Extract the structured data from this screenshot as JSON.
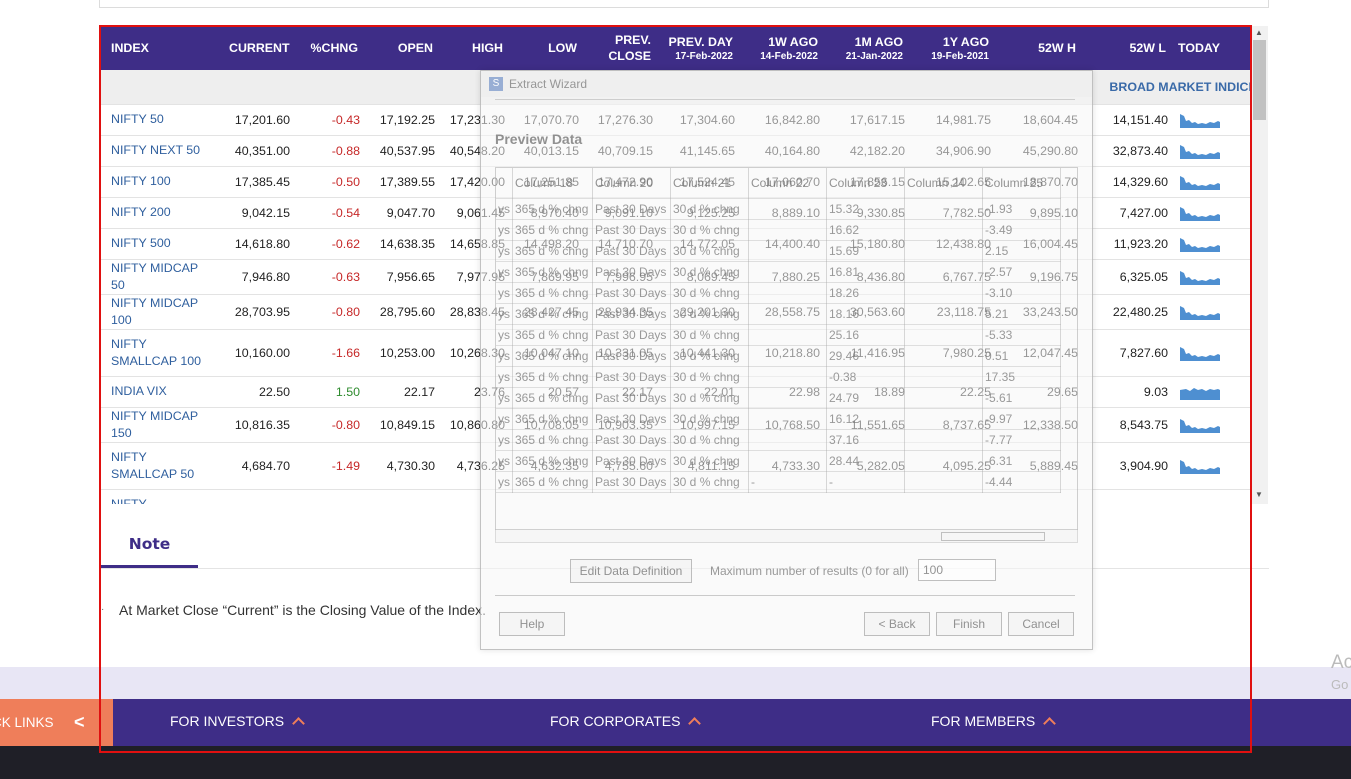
{
  "table": {
    "headers": [
      {
        "label": "INDEX",
        "sub": ""
      },
      {
        "label": "CURRENT",
        "sub": ""
      },
      {
        "label": "%CHNG",
        "sub": ""
      },
      {
        "label": "OPEN",
        "sub": ""
      },
      {
        "label": "HIGH",
        "sub": ""
      },
      {
        "label": "LOW",
        "sub": ""
      },
      {
        "label": "PREV. CLOSE",
        "sub": ""
      },
      {
        "label": "PREV. DAY",
        "sub": "17-Feb-2022"
      },
      {
        "label": "1W AGO",
        "sub": "14-Feb-2022"
      },
      {
        "label": "1M AGO",
        "sub": "21-Jan-2022"
      },
      {
        "label": "1Y AGO",
        "sub": "19-Feb-2021"
      },
      {
        "label": "52W H",
        "sub": ""
      },
      {
        "label": "52W L",
        "sub": ""
      },
      {
        "label": "TODAY",
        "sub": ""
      }
    ],
    "group": "BROAD MARKET INDICES",
    "rows": [
      {
        "name": "NIFTY 50",
        "current": "17,201.60",
        "chng": "-0.43",
        "open": "17,192.25",
        "high": "17,231.30",
        "low": "17,070.70",
        "prev_close": "17,276.30",
        "prev_day": "17,304.60",
        "w1": "16,842.80",
        "m1": "17,617.15",
        "y1": "14,981.75",
        "h52": "18,604.45",
        "l52": "14,151.40",
        "dir": "neg",
        "spark": "down"
      },
      {
        "name": "NIFTY NEXT 50",
        "current": "40,351.00",
        "chng": "-0.88",
        "open": "40,537.95",
        "high": "40,548.20",
        "low": "40,013.15",
        "prev_close": "40,709.15",
        "prev_day": "41,145.65",
        "w1": "40,164.80",
        "m1": "42,182.20",
        "y1": "34,906.90",
        "h52": "45,290.80",
        "l52": "32,873.40",
        "dir": "neg",
        "spark": "down"
      },
      {
        "name": "NIFTY 100",
        "current": "17,385.45",
        "chng": "-0.50",
        "open": "17,389.55",
        "high": "17,420.00",
        "low": "17,251.85",
        "prev_close": "17,472.90",
        "prev_day": "17,524.45",
        "w1": "17,060.70",
        "m1": "17,856.15",
        "y1": "15,102.65",
        "h52": "18,870.70",
        "l52": "14,329.60",
        "dir": "neg",
        "spark": "down"
      },
      {
        "name": "NIFTY 200",
        "current": "9,042.15",
        "chng": "-0.54",
        "open": "9,047.70",
        "high": "9,061.45",
        "low": "8,970.40",
        "prev_close": "9,091.10",
        "prev_day": "9,125.25",
        "w1": "8,889.10",
        "m1": "9,330.85",
        "y1": "7,782.50",
        "h52": "9,895.10",
        "l52": "7,427.00",
        "dir": "neg",
        "spark": "down"
      },
      {
        "name": "NIFTY 500",
        "current": "14,618.80",
        "chng": "-0.62",
        "open": "14,638.35",
        "high": "14,658.85",
        "low": "14,498.20",
        "prev_close": "14,710.70",
        "prev_day": "14,772.05",
        "w1": "14,400.40",
        "m1": "15,180.80",
        "y1": "12,438.80",
        "h52": "16,004.45",
        "l52": "11,923.20",
        "dir": "neg",
        "spark": "down"
      },
      {
        "name": "NIFTY MIDCAP 50",
        "current": "7,946.80",
        "chng": "-0.63",
        "open": "7,956.65",
        "high": "7,977.95",
        "low": "7,869.95",
        "prev_close": "7,996.95",
        "prev_day": "8,069.45",
        "w1": "7,880.25",
        "m1": "8,436.80",
        "y1": "6,767.75",
        "h52": "9,196.75",
        "l52": "6,325.05",
        "dir": "neg",
        "spark": "down"
      },
      {
        "name": "NIFTY MIDCAP 100",
        "current": "28,703.95",
        "chng": "-0.80",
        "open": "28,795.60",
        "high": "28,838.45",
        "low": "28,427.45",
        "prev_close": "28,934.35",
        "prev_day": "29,201.30",
        "w1": "28,558.75",
        "m1": "30,563.60",
        "y1": "23,118.75",
        "h52": "33,243.50",
        "l52": "22,480.25",
        "dir": "neg",
        "spark": "down"
      },
      {
        "name": "NIFTY SMALLCAP 100",
        "current": "10,160.00",
        "chng": "-1.66",
        "open": "10,253.00",
        "high": "10,268.30",
        "low": "10,047.10",
        "prev_close": "10,331.05",
        "prev_day": "10,441.30",
        "w1": "10,218.80",
        "m1": "11,416.95",
        "y1": "7,980.25",
        "h52": "12,047.45",
        "l52": "7,827.60",
        "dir": "neg",
        "spark": "down",
        "tall": true
      },
      {
        "name": "INDIA VIX",
        "current": "22.50",
        "chng": "1.50",
        "open": "22.17",
        "high": "23.76",
        "low": "20.57",
        "prev_close": "22.17",
        "prev_day": "22.01",
        "w1": "22.98",
        "m1": "18.89",
        "y1": "22.25",
        "h52": "29.65",
        "l52": "9.03",
        "dir": "pos",
        "spark": "flat"
      },
      {
        "name": "NIFTY MIDCAP 150",
        "current": "10,816.35",
        "chng": "-0.80",
        "open": "10,849.15",
        "high": "10,860.80",
        "low": "10,708.05",
        "prev_close": "10,903.35",
        "prev_day": "10,997.15",
        "w1": "10,768.50",
        "m1": "11,551.65",
        "y1": "8,737.65",
        "h52": "12,338.50",
        "l52": "8,543.75",
        "dir": "neg",
        "spark": "down"
      },
      {
        "name": "NIFTY SMALLCAP 50",
        "current": "4,684.70",
        "chng": "-1.49",
        "open": "4,730.30",
        "high": "4,736.25",
        "low": "4,632.35",
        "prev_close": "4,755.60",
        "prev_day": "4,811.15",
        "w1": "4,733.30",
        "m1": "5,282.05",
        "y1": "4,095.25",
        "h52": "5,889.45",
        "l52": "3,904.90",
        "dir": "neg",
        "spark": "down",
        "tall": true
      },
      {
        "name": "NIFTY SMALLCAP",
        "current": "",
        "chng": "",
        "open": "",
        "high": "",
        "low": "",
        "prev_close": "",
        "prev_day": "",
        "w1": "",
        "m1": "",
        "y1": "",
        "h52": "",
        "l52": "",
        "dir": "neg",
        "spark": "none",
        "cut": true
      }
    ]
  },
  "note": {
    "tab": "Note",
    "text": "At Market Close “Current” is the Closing Value of the Index."
  },
  "footer": {
    "quick_links": "CK LINKS",
    "quick_chevron": "<",
    "items": [
      "FOR INVESTORS",
      "FOR CORPORATES",
      "FOR MEMBERS"
    ]
  },
  "watermark": {
    "line1": "Ac",
    "line2": "Go"
  },
  "wizard": {
    "title": "Extract Wizard",
    "logo": "S",
    "heading": "Preview Data",
    "columns": [
      "Column 18",
      "Column 20",
      "Column 21",
      "Column 22",
      "Column 23",
      "Column 24",
      "Column 25"
    ],
    "grid_rows": [
      [
        "ys",
        "365 d % chng",
        "Past 30 Days",
        "30 d % chng",
        "",
        "15.32",
        "",
        "-1.93"
      ],
      [
        "ys",
        "365 d % chng",
        "Past 30 Days",
        "30 d % chng",
        "",
        "16.62",
        "",
        "-3.49"
      ],
      [
        "ys",
        "365 d % chng",
        "Past 30 Days",
        "30 d % chng",
        "",
        "15.69",
        "",
        "2.15"
      ],
      [
        "ys",
        "365 d % chng",
        "Past 30 Days",
        "30 d % chng",
        "",
        "16.81",
        "",
        "-2.57"
      ],
      [
        "ys",
        "365 d % chng",
        "Past 30 Days",
        "30 d % chng",
        "",
        "18.26",
        "",
        "-3.10"
      ],
      [
        "ys",
        "365 d % chng",
        "Past 30 Days",
        "30 d % chng",
        "",
        "18.16",
        "",
        "5.21"
      ],
      [
        "ys",
        "365 d % chng",
        "Past 30 Days",
        "30 d % chng",
        "",
        "25.16",
        "",
        "-5.33"
      ],
      [
        "ys",
        "365 d % chng",
        "Past 30 Days",
        "30 d % chng",
        "",
        "29.46",
        "",
        "0.51"
      ],
      [
        "ys",
        "365 d % chng",
        "Past 30 Days",
        "30 d % chng",
        "",
        "-0.38",
        "",
        "17.35"
      ],
      [
        "ys",
        "365 d % chng",
        "Past 30 Days",
        "30 d % chng",
        "",
        "24.79",
        "",
        "-5.61"
      ],
      [
        "ys",
        "365 d % chng",
        "Past 30 Days",
        "30 d % chng",
        "",
        "16.12",
        "",
        "-9.97"
      ],
      [
        "ys",
        "365 d % chng",
        "Past 30 Days",
        "30 d % chng",
        "",
        "37.16",
        "",
        "-7.77"
      ],
      [
        "ys",
        "365 d % chng",
        "Past 30 Days",
        "30 d % chng",
        "",
        "28.44",
        "",
        "-6.31"
      ],
      [
        "ys",
        "365 d % chng",
        "Past 30 Days",
        "30 d % chng",
        "-",
        "-",
        "",
        "-4.44"
      ]
    ],
    "edit_button": "Edit Data Definition",
    "max_label": "Maximum number of results (0 for all)",
    "max_value": "100",
    "help": "Help",
    "back": "< Back",
    "finish": "Finish",
    "cancel": "Cancel"
  }
}
